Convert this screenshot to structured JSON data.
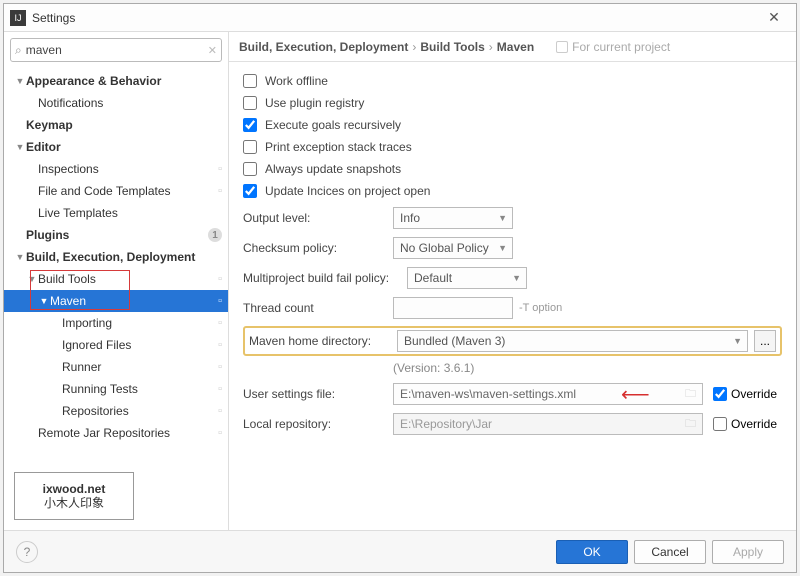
{
  "window": {
    "title": "Settings",
    "close": "✕"
  },
  "search": {
    "value": "maven",
    "icon": "⌕",
    "clear": "✕"
  },
  "tree": {
    "appearance": "Appearance & Behavior",
    "notifications": "Notifications",
    "keymap": "Keymap",
    "editor": "Editor",
    "inspections": "Inspections",
    "file_code_templates": "File and Code Templates",
    "live_templates": "Live Templates",
    "plugins": "Plugins",
    "plugins_badge": "1",
    "bed": "Build, Execution, Deployment",
    "build_tools": "Build Tools",
    "maven": "Maven",
    "importing": "Importing",
    "ignored_files": "Ignored Files",
    "runner": "Runner",
    "running_tests": "Running Tests",
    "repositories": "Repositories",
    "remote_jar": "Remote Jar Repositories"
  },
  "logo": {
    "line1": "ixwood.net",
    "line2": "小木人印象"
  },
  "breadcrumb": {
    "a": "Build, Execution, Deployment",
    "b": "Build Tools",
    "c": "Maven",
    "note": "For current project"
  },
  "options": {
    "work_offline": "Work offline",
    "use_plugin_registry": "Use plugin registry",
    "execute_goals_recursively": "Execute goals recursively",
    "print_exception": "Print exception stack traces",
    "always_update": "Always update snapshots",
    "update_indices": "Update Incices on project open"
  },
  "fields": {
    "output_level_label": "Output level:",
    "output_level_value": "Info",
    "checksum_label": "Checksum policy:",
    "checksum_value": "No Global Policy",
    "multiproject_label": "Multiproject build fail policy:",
    "multiproject_value": "Default",
    "thread_label": "Thread count",
    "thread_value": "",
    "thread_hint": "-T option",
    "home_label": "Maven home directory:",
    "home_value": "Bundled (Maven 3)",
    "home_version": "(Version: 3.6.1)",
    "user_settings_label": "User settings file:",
    "user_settings_value": "E:\\maven-ws\\maven-settings.xml",
    "local_repo_label": "Local repository:",
    "local_repo_value": "E:\\Repository\\Jar",
    "override": "Override",
    "ellipsis": "..."
  },
  "footer": {
    "help": "?",
    "ok": "OK",
    "cancel": "Cancel",
    "apply": "Apply"
  }
}
